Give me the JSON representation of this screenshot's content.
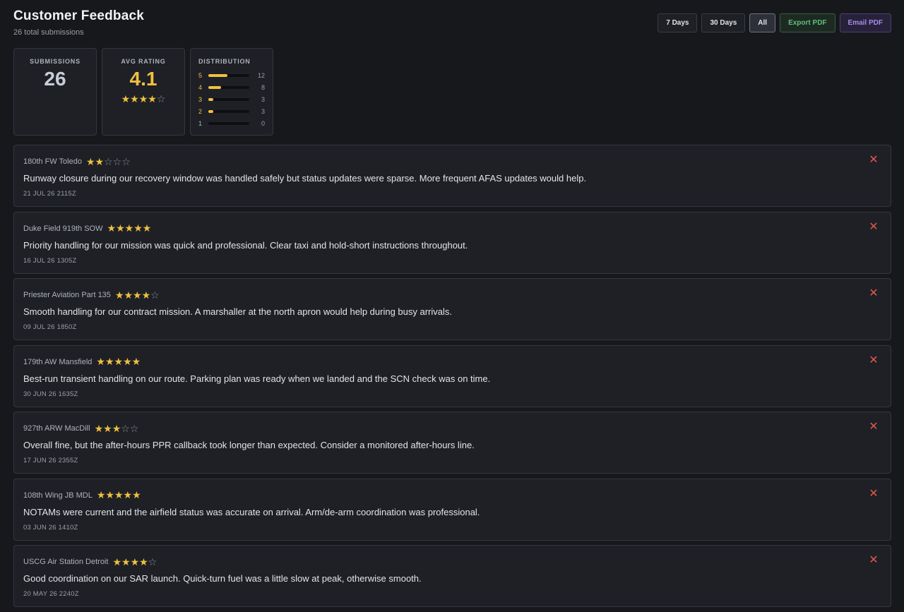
{
  "header": {
    "title": "Customer Feedback",
    "subtitle": "26 total submissions"
  },
  "toolbar": {
    "days7": "7 Days",
    "days30": "30 Days",
    "all": "All",
    "export": "Export PDF",
    "email": "Email PDF"
  },
  "stats": {
    "submissions_label": "SUBMISSIONS",
    "submissions_value": "26",
    "avg_label": "AVG RATING",
    "avg_value": "4.1",
    "avg_stars": 4,
    "distribution_label": "DISTRIBUTION",
    "distribution": [
      {
        "stars": "5",
        "count": "12",
        "fraction": 0.46
      },
      {
        "stars": "4",
        "count": "8",
        "fraction": 0.31
      },
      {
        "stars": "3",
        "count": "3",
        "fraction": 0.12
      },
      {
        "stars": "2",
        "count": "3",
        "fraction": 0.12
      },
      {
        "stars": "1",
        "count": "0",
        "fraction": 0
      }
    ]
  },
  "feedback": [
    {
      "unit": "180th FW Toledo",
      "rating": 2,
      "text": "Runway closure during our recovery window was handled safely but status updates were sparse. More frequent AFAS updates would help.",
      "date": "21 JUL 26 2115Z"
    },
    {
      "unit": "Duke Field 919th SOW",
      "rating": 5,
      "text": "Priority handling for our mission was quick and professional. Clear taxi and hold-short instructions throughout.",
      "date": "16 JUL 26 1305Z"
    },
    {
      "unit": "Priester Aviation Part 135",
      "rating": 4,
      "text": "Smooth handling for our contract mission. A marshaller at the north apron would help during busy arrivals.",
      "date": "09 JUL 26 1850Z"
    },
    {
      "unit": "179th AW Mansfield",
      "rating": 5,
      "text": "Best-run transient handling on our route. Parking plan was ready when we landed and the SCN check was on time.",
      "date": "30 JUN 26 1635Z"
    },
    {
      "unit": "927th ARW MacDill",
      "rating": 3,
      "text": "Overall fine, but the after-hours PPR callback took longer than expected. Consider a monitored after-hours line.",
      "date": "17 JUN 26 2355Z"
    },
    {
      "unit": "108th Wing JB MDL",
      "rating": 5,
      "text": "NOTAMs were current and the airfield status was accurate on arrival. Arm/de-arm coordination was professional.",
      "date": "03 JUN 26 1410Z"
    },
    {
      "unit": "USCG Air Station Detroit",
      "rating": 4,
      "text": "Good coordination on our SAR launch. Quick-turn fuel was a little slow at peak, otherwise smooth.",
      "date": "20 MAY 26 2240Z"
    }
  ],
  "colors": {
    "star": "#f0c040",
    "close": "#e4574a",
    "export": "#5fc07a",
    "email": "#a88ce8"
  },
  "icons": {
    "star_full": "★",
    "star_empty": "☆",
    "close": "✕"
  }
}
